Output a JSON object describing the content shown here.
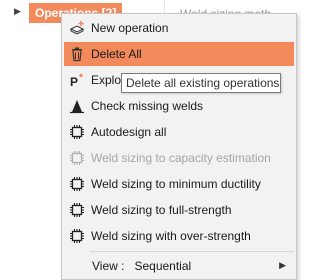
{
  "tree": {
    "node_label": "Operations [2]",
    "background_text": "Weld sizing meth"
  },
  "menu": {
    "items": [
      {
        "label": "New operation",
        "icon": "new-operation-icon"
      },
      {
        "label": "Delete All",
        "icon": "trash-icon"
      },
      {
        "label": "Explode",
        "icon": "explode-icon"
      },
      {
        "label": "Check missing welds",
        "icon": "weld-check-icon"
      },
      {
        "label": "Autodesign all",
        "icon": "chip-icon"
      },
      {
        "label": "Weld sizing to capacity estimation",
        "icon": "chip-icon"
      },
      {
        "label": "Weld sizing to minimum ductility",
        "icon": "chip-icon"
      },
      {
        "label": "Weld sizing to full-strength",
        "icon": "chip-icon"
      },
      {
        "label": "Weld sizing with over-strength",
        "icon": "chip-icon"
      }
    ],
    "view_label": "View :",
    "view_value": "Sequential"
  },
  "tooltip": {
    "text": "Delete all existing operations"
  },
  "colors": {
    "accent": "#f28a5c",
    "menu_bg": "#f2f2f2",
    "disabled_text": "#a6a6a6"
  }
}
